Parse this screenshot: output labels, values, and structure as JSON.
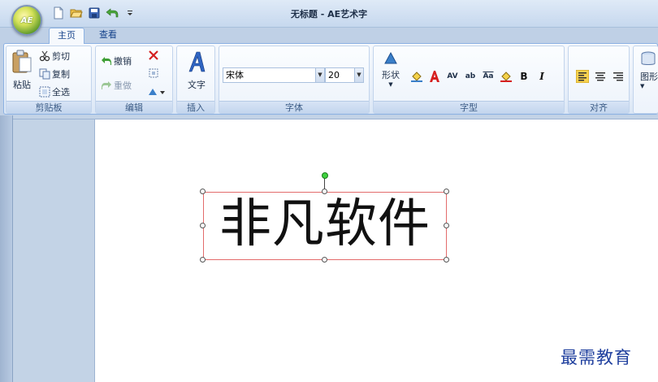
{
  "app": {
    "orb_label": "AE",
    "window_title": "无标题 - AE艺术字"
  },
  "tabs": [
    {
      "label": "主页",
      "active": true
    },
    {
      "label": "查看",
      "active": false
    }
  ],
  "ribbon": {
    "clipboard": {
      "label": "剪贴板",
      "paste": "粘贴",
      "cut": "剪切",
      "copy": "复制",
      "select_all": "全选"
    },
    "edit": {
      "label": "编辑",
      "undo": "撤销",
      "redo": "重做"
    },
    "insert": {
      "label": "插入",
      "text": "文字"
    },
    "font": {
      "label": "字体",
      "family": "宋体",
      "size": "20"
    },
    "glyph": {
      "label": "字型",
      "shape": "形状",
      "spacing_av": "AV",
      "ab": "ab",
      "aa": "Aa",
      "bold": "B",
      "italic": "I"
    },
    "align": {
      "label": "对齐"
    },
    "shapes": {
      "label": "图形"
    }
  },
  "document": {
    "art_text": "非凡软件"
  },
  "watermark": "最需教育",
  "colors": {
    "accent": "#15428b",
    "selection_border": "#e36b6b",
    "rotate_handle": "#3fd13f",
    "watermark": "#1f3f9e"
  }
}
